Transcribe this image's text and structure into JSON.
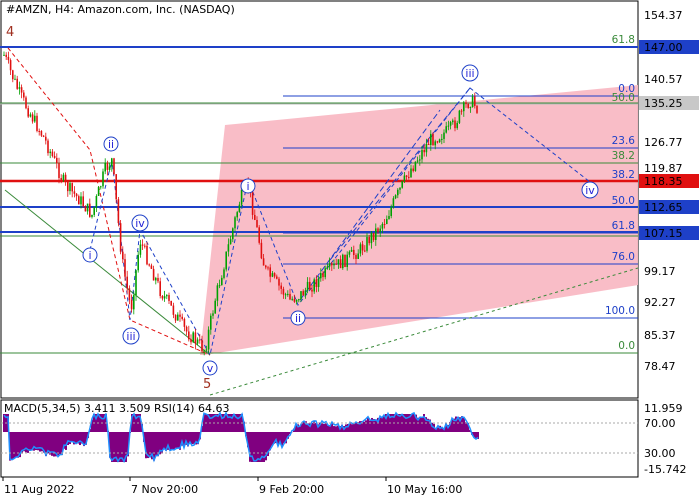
{
  "header": {
    "title": "#AMZN, H4:  Amazon.com, Inc. (NASDAQ)"
  },
  "macd_header": "MACD(5,34,5) 3.411 3.509 RSI(14) 64.63",
  "price_axis": [
    "154.37",
    "147.00",
    "140.57",
    "135.25",
    "126.77",
    "119.87",
    "118.35",
    "112.65",
    "107.15",
    "99.17",
    "92.27",
    "85.37",
    "78.47"
  ],
  "indicator_axis": [
    "11.959",
    "70.00",
    "30.00",
    "-15.742"
  ],
  "time_axis": [
    "11 Aug 2022",
    "7 Nov 20:00",
    "9 Feb 20:00",
    "10 May 16:00"
  ],
  "price_tags": [
    {
      "label": "147.00",
      "color": "#1e40c8"
    },
    {
      "label": "135.25",
      "color": "#c8c8c8"
    },
    {
      "label": "118.35",
      "color": "#e01010"
    },
    {
      "label": "112.65",
      "color": "#1e40c8"
    },
    {
      "label": "107.15",
      "color": "#1e40c8"
    }
  ],
  "fib_levels_blue": [
    "0.0",
    "23.6",
    "38.2",
    "50.0",
    "61.8",
    "76.0",
    "100.0"
  ],
  "fib_levels_green": [
    "61.8",
    "50.0",
    "38.2",
    "0.0"
  ],
  "wave_labels": {
    "major_top": "4",
    "major_bottom": "5",
    "minor": [
      "i",
      "ii",
      "iii",
      "iv",
      "v",
      "i",
      "ii",
      "iii",
      "iv"
    ]
  },
  "colors": {
    "channel_fill": "#f9b9c4",
    "bull_candle": "#00a000",
    "bear_candle": "#e01010",
    "wave_blue": "#1e40c8",
    "fib_green": "#3a8a3a",
    "macd_hist": "#800080",
    "macd_line": "#1e90ff"
  }
}
